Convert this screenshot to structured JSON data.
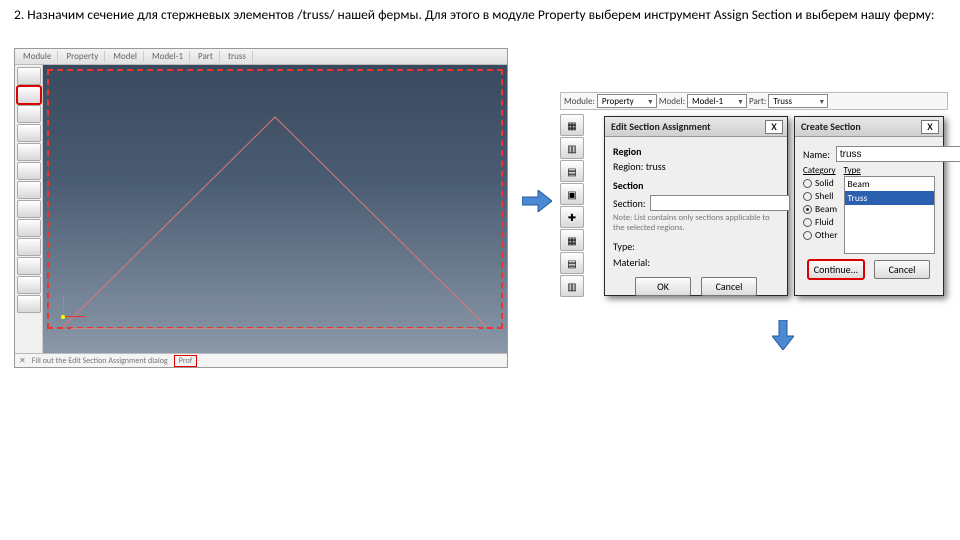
{
  "instruction": "2. Назначим сечение для стержневых элементов /truss/ нашей фермы. Для этого в модуле Property выберем инструмент Assign Section и выберем нашу ферму:",
  "viewport": {
    "toolbar": [
      "Module",
      "Property",
      "Model",
      "Model-1",
      "Part",
      "truss"
    ],
    "status_left": "Fill out the Edit Section Assignment dialog",
    "status_hot": "Prof"
  },
  "context_bar": {
    "module_label": "Module:",
    "module_val": "Property",
    "model_label": "Model:",
    "model_val": "Model-1",
    "part_label": "Part:",
    "part_val": "Truss"
  },
  "edit_dlg": {
    "title": "Edit Section Assignment",
    "region_label": "Region",
    "region_value": "Region:  truss",
    "section_group": "Section",
    "section_label": "Section:",
    "section_value": "",
    "note": "Note:  List contains only sections applicable to the selected regions.",
    "type_label": "Type:",
    "material_label": "Material:",
    "ok": "OK",
    "cancel": "Cancel"
  },
  "create_dlg": {
    "title": "Create Section",
    "name_label": "Name:",
    "name_value": "truss",
    "category_label": "Category",
    "type_label": "Type",
    "categories": [
      "Solid",
      "Shell",
      "Beam",
      "Fluid",
      "Other"
    ],
    "selected_category": "Beam",
    "types": [
      "Beam",
      "Truss"
    ],
    "selected_type": "Truss",
    "continue": "Continue...",
    "cancel": "Cancel"
  }
}
